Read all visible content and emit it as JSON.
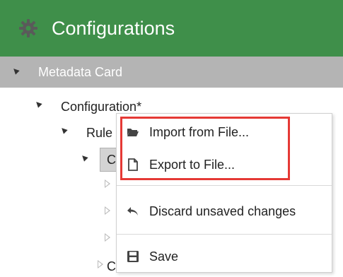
{
  "header": {
    "title": "Configurations",
    "gear_icon": "gear-icon",
    "background": "#3f8f4a"
  },
  "section": {
    "label": "Metadata Card",
    "expand_icon": "expanded-triangle-icon"
  },
  "tree": {
    "configuration_label": "Configuration*",
    "rule_label": "Rule",
    "child_label_partial": "C",
    "bottom_label_partial": "C"
  },
  "context_menu": {
    "items": [
      {
        "label": "Import from File...",
        "icon": "folder-open-icon"
      },
      {
        "label": "Export to File...",
        "icon": "document-icon"
      },
      {
        "label": "Discard unsaved changes",
        "icon": "undo-icon"
      },
      {
        "label": "Save",
        "icon": "save-icon"
      }
    ]
  },
  "annotation": {
    "color": "#e53935"
  }
}
